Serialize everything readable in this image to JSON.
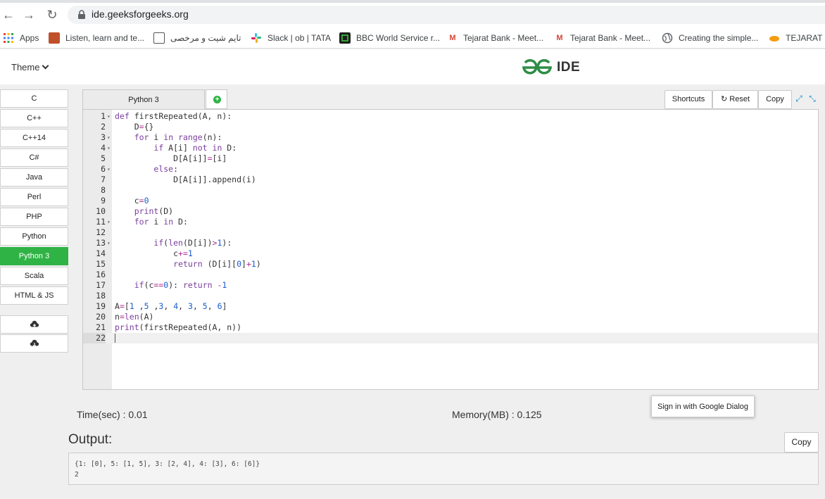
{
  "browser": {
    "url": "ide.geeksforgeeks.org"
  },
  "bookmarks": [
    {
      "label": "Apps",
      "icon": "apps-grid-icon",
      "color": "#ea4335"
    },
    {
      "label": "Listen, learn and te...",
      "icon": "bbc-learning-icon",
      "color": "#c0502a"
    },
    {
      "label": "تایم شیت و مرخصی",
      "icon": "timesheet-icon",
      "color": "#555555"
    },
    {
      "label": "Slack | ob | TATA",
      "icon": "slack-icon",
      "color": "#e01e5a"
    },
    {
      "label": "BBC World Service r...",
      "icon": "bbc-world-icon",
      "color": "#1e1e1e"
    },
    {
      "label": "Tejarat Bank - Meet...",
      "icon": "gmail-icon",
      "color": "#d44638"
    },
    {
      "label": "Tejarat Bank - Meet...",
      "icon": "gmail-icon",
      "color": "#d44638"
    },
    {
      "label": "Creating the simple...",
      "icon": "globe-icon",
      "color": "#5f6368"
    },
    {
      "label": "TEJARAT O",
      "icon": "orange-leaf-icon",
      "color": "#f39c12"
    }
  ],
  "header": {
    "theme_label": "Theme",
    "logo_text": "IDE",
    "brand_color": "#2f8d46"
  },
  "languages": [
    {
      "label": "C",
      "active": false
    },
    {
      "label": "C++",
      "active": false
    },
    {
      "label": "C++14",
      "active": false
    },
    {
      "label": "C#",
      "active": false
    },
    {
      "label": "Java",
      "active": false
    },
    {
      "label": "Perl",
      "active": false
    },
    {
      "label": "PHP",
      "active": false
    },
    {
      "label": "Python",
      "active": false
    },
    {
      "label": "Python 3",
      "active": true
    },
    {
      "label": "Scala",
      "active": false
    },
    {
      "label": "HTML & JS",
      "active": false
    }
  ],
  "editor": {
    "tab_label": "Python 3",
    "shortcuts_label": "Shortcuts",
    "reset_label": "Reset",
    "copy_label": "Copy",
    "current_line": 22,
    "lines": [
      {
        "n": "1",
        "fold": true,
        "code": "def firstRepeated(A, n):"
      },
      {
        "n": "2",
        "fold": false,
        "code": "    D={}"
      },
      {
        "n": "3",
        "fold": true,
        "code": "    for i in range(n):"
      },
      {
        "n": "4",
        "fold": true,
        "code": "        if A[i] not in D:"
      },
      {
        "n": "5",
        "fold": false,
        "code": "            D[A[i]]=[i]"
      },
      {
        "n": "6",
        "fold": true,
        "code": "        else:"
      },
      {
        "n": "7",
        "fold": false,
        "code": "            D[A[i]].append(i)"
      },
      {
        "n": "8",
        "fold": false,
        "code": ""
      },
      {
        "n": "9",
        "fold": false,
        "code": "    c=0"
      },
      {
        "n": "10",
        "fold": false,
        "code": "    print(D)"
      },
      {
        "n": "11",
        "fold": true,
        "code": "    for i in D:"
      },
      {
        "n": "12",
        "fold": false,
        "code": ""
      },
      {
        "n": "13",
        "fold": true,
        "code": "        if(len(D[i])>1):"
      },
      {
        "n": "14",
        "fold": false,
        "code": "            c+=1"
      },
      {
        "n": "15",
        "fold": false,
        "code": "            return (D[i][0]+1)"
      },
      {
        "n": "16",
        "fold": false,
        "code": ""
      },
      {
        "n": "17",
        "fold": false,
        "code": "    if(c==0): return -1"
      },
      {
        "n": "18",
        "fold": false,
        "code": ""
      },
      {
        "n": "19",
        "fold": false,
        "code": "A=[1 ,5 ,3, 4, 3, 5, 6]"
      },
      {
        "n": "20",
        "fold": false,
        "code": "n=len(A)"
      },
      {
        "n": "21",
        "fold": false,
        "code": "print(firstRepeated(A, n))"
      },
      {
        "n": "22",
        "fold": false,
        "code": ""
      }
    ]
  },
  "stats": {
    "time": "Time(sec) : 0.01",
    "memory": "Memory(MB) : 0.125"
  },
  "signin_label": "Sign in with Google Dialog",
  "output": {
    "label": "Output:",
    "copy_label": "Copy",
    "lines": [
      "{1: [0], 5: [1, 5], 3: [2, 4], 4: [3], 6: [6]}",
      "2"
    ]
  }
}
